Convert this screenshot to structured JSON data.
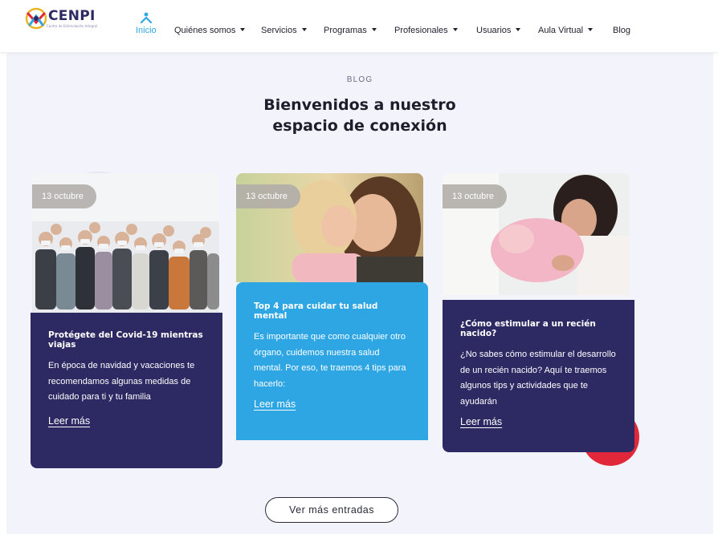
{
  "header": {
    "logo_text": "CENPI",
    "logo_tagline": "Centro de Estimulación Integral",
    "nav": [
      {
        "label": "Inicio",
        "active": true,
        "has_caret": false
      },
      {
        "label": "Quiénes somos",
        "active": false,
        "has_caret": true
      },
      {
        "label": "Servicios",
        "active": false,
        "has_caret": true
      },
      {
        "label": "Programas",
        "active": false,
        "has_caret": true
      },
      {
        "label": "Profesionales",
        "active": false,
        "has_caret": true
      },
      {
        "label": "Usuarios",
        "active": false,
        "has_caret": true
      },
      {
        "label": "Aula Virtual",
        "active": false,
        "has_caret": true
      },
      {
        "label": "Blog",
        "active": false,
        "has_caret": false
      }
    ]
  },
  "section": {
    "eyebrow": "BLOG",
    "title_line1": "Bienvenidos a nuestro",
    "title_line2": "espacio de conexión"
  },
  "cards": [
    {
      "date": "13 octubre",
      "title": "Protégete del Covid-19 mientras viajas",
      "text": "En época de navidad y vacaciones te recomendamos algunas medidas de cuidado para ti y tu familia",
      "link": "Leer más",
      "image": "group-of-people-wearing-masks"
    },
    {
      "date": "13 octubre",
      "title": "Top 4 para cuidar tu salud mental",
      "text": "Es importante que como cualquier otro órgano, cuidemos nuestra salud mental. Por eso, te traemos 4 tips para hacerlo:",
      "link": "Leer más",
      "image": "mother-and-daughter-hug"
    },
    {
      "date": "13 octubre",
      "title": "¿Cómo estimular a un recién nacido?",
      "text": "¿No sabes cómo estimular el desarrollo de un recién nacido? Aquí te traemos algunos tips y actividades que te ayudarán",
      "link": "Leer más",
      "image": "mother-holding-newborn"
    }
  ],
  "more_button": "Ver más entradas",
  "colors": {
    "brand_navy": "#2c2963",
    "brand_blue": "#2ea6e4",
    "accent_red": "#e0283a",
    "nav_active": "#2fa6e6",
    "section_bg": "#f3f4fb"
  }
}
